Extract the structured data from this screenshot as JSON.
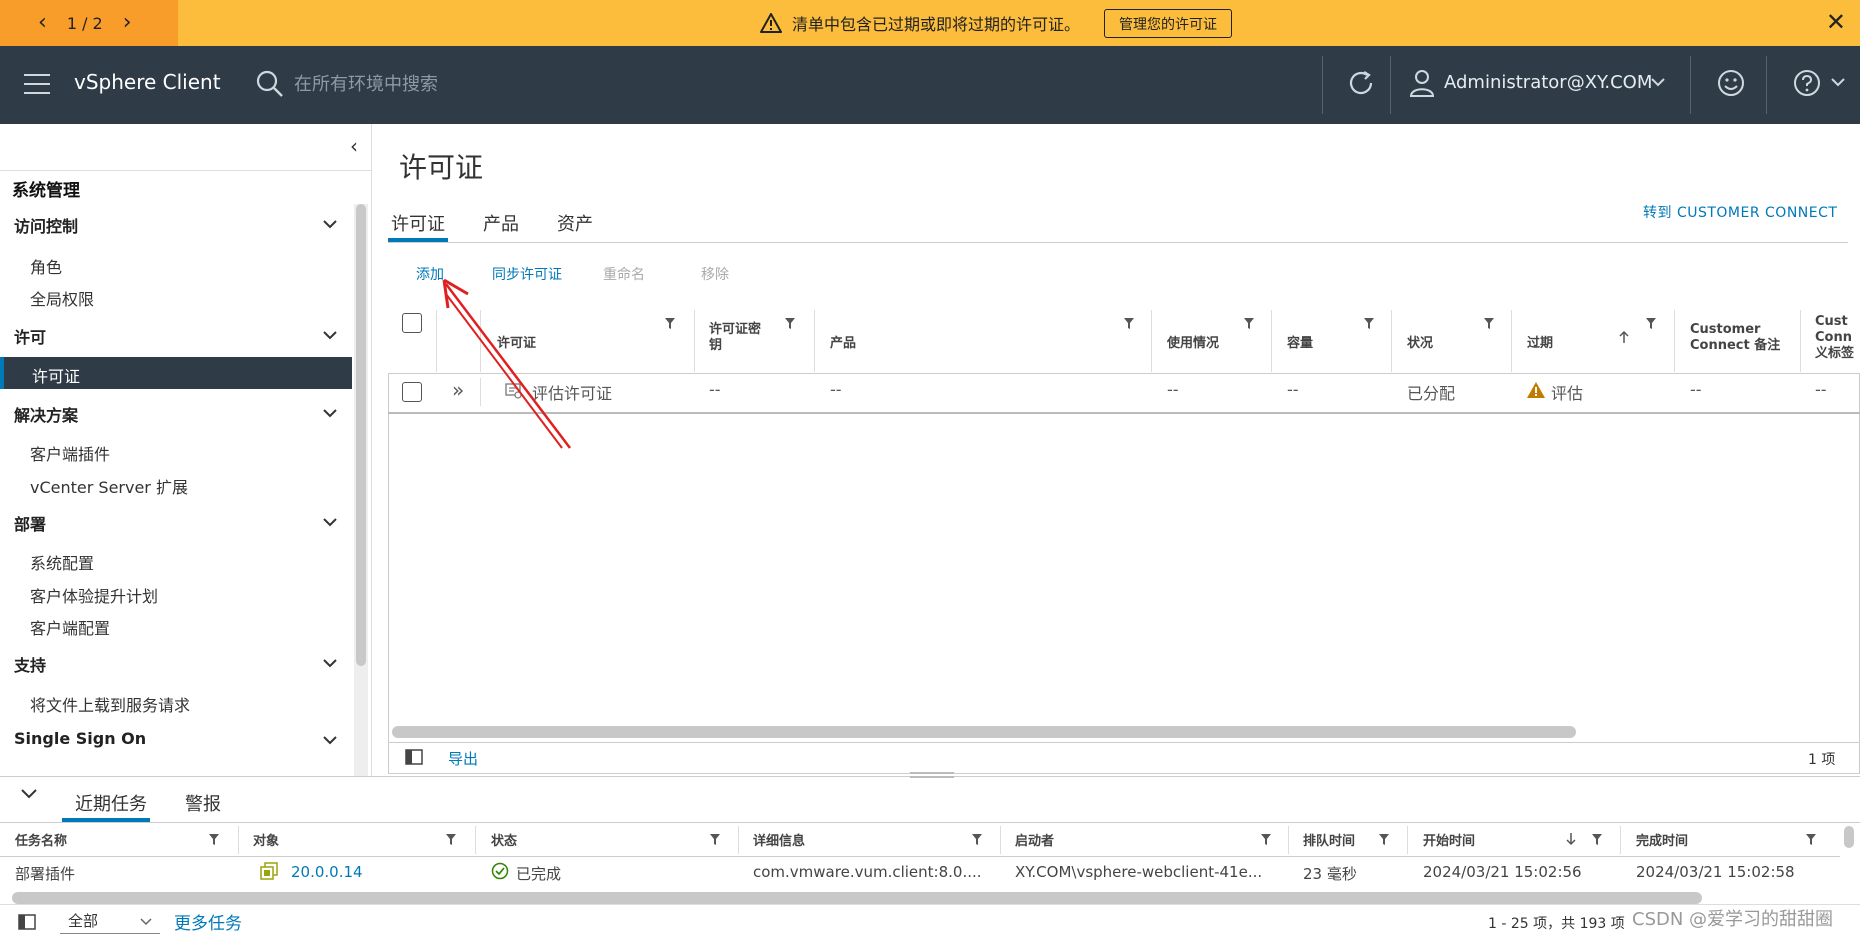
{
  "banner": {
    "pager": "1 / 2",
    "message": "清单中包含已过期或即将过期的许可证。",
    "button": "管理您的许可证"
  },
  "header": {
    "title": "vSphere Client",
    "search_placeholder": "在所有环境中搜索",
    "user": "Administrator@XY.COM"
  },
  "sidebar": {
    "heading": "系统管理",
    "sections": [
      {
        "label": "访问控制",
        "items": [
          "角色",
          "全局权限"
        ]
      },
      {
        "label": "许可",
        "items": [
          "许可证"
        ]
      },
      {
        "label": "解决方案",
        "items": [
          "客户端插件",
          "vCenter Server 扩展"
        ]
      },
      {
        "label": "部署",
        "items": [
          "系统配置",
          "客户体验提升计划",
          "客户端配置"
        ]
      },
      {
        "label": "支持",
        "items": [
          "将文件上载到服务请求"
        ]
      },
      {
        "label": "Single Sign On",
        "items": []
      }
    ]
  },
  "main": {
    "title": "许可证",
    "tabs": [
      "许可证",
      "产品",
      "资产"
    ],
    "goto_link": "转到 CUSTOMER CONNECT",
    "actions": {
      "add": "添加",
      "sync": "同步许可证",
      "rename": "重命名",
      "remove": "移除"
    },
    "grid": {
      "columns": [
        "许可证",
        "许可证密\n钥",
        "产品",
        "使用情况",
        "容量",
        "状况",
        "过期",
        "Customer\nConnect 备注",
        "Cust\nConn\n义标签"
      ],
      "row": {
        "license": "评估许可证",
        "key": "--",
        "product": "--",
        "usage": "--",
        "capacity": "--",
        "state": "已分配",
        "expiration": "评估",
        "note": "--",
        "tags": "--"
      },
      "export": "导出",
      "count": "1 项"
    }
  },
  "tasks": {
    "tabs": [
      "近期任务",
      "警报"
    ],
    "columns": [
      "任务名称",
      "对象",
      "状态",
      "详细信息",
      "启动者",
      "排队时间",
      "开始时间",
      "完成时间"
    ],
    "row": {
      "name": "部署插件",
      "target": "20.0.0.14",
      "status": "已完成",
      "details": "com.vmware.vum.client:8.0....",
      "initiator": "XY.COM\\vsphere-webclient-41e...",
      "queued": "23 毫秒",
      "start": "2024/03/21 15:02:56",
      "completion": "2024/03/21 15:02:58"
    },
    "filter": "全部",
    "more": "更多任务",
    "range": "1 - 25 项，共 193 项"
  },
  "watermark": "CSDN @爱学习的甜甜圈",
  "colors": {
    "accent": "#0079b8",
    "header_bg": "#2f3c48",
    "banner_bg": "#fbbd3b",
    "warning": "#c27b00",
    "success": "#2f8400"
  }
}
